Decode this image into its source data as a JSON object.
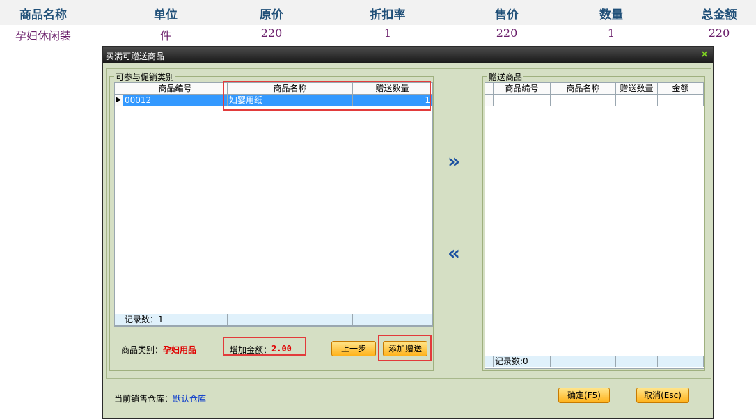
{
  "background_table": {
    "headers": [
      "商品名称",
      "单位",
      "原价",
      "折扣率",
      "售价",
      "数量",
      "总金额"
    ],
    "row": [
      "孕妇休闲装",
      "件",
      "220",
      "1",
      "220",
      "1",
      "220"
    ]
  },
  "dialog": {
    "title": "买满可赠送商品",
    "close_label": "×",
    "left_group": {
      "legend": "可参与促销类别",
      "headers": [
        "商品编号",
        "商品名称",
        "赠送数量"
      ],
      "row": {
        "code": "00012",
        "name": "妇婴用纸",
        "qty": "1"
      },
      "record_count": "记录数：1"
    },
    "right_group": {
      "legend": "赠送商品",
      "headers": [
        "商品编号",
        "商品名称",
        "赠送数量",
        "金额"
      ],
      "record_count": "记录数:0"
    },
    "category_label": "商品类别：",
    "category_value": "孕妇用品",
    "add_amount_label": "增加金额：",
    "add_amount_value": "2.00",
    "prev_button": "上一步",
    "add_gift_button": "添加赠送",
    "move_right": "»",
    "move_left": "«",
    "warehouse_label": "当前销售仓库：",
    "warehouse_value": "默认仓库",
    "ok_button": "确定(F5)",
    "cancel_button": "取消(Esc)"
  }
}
